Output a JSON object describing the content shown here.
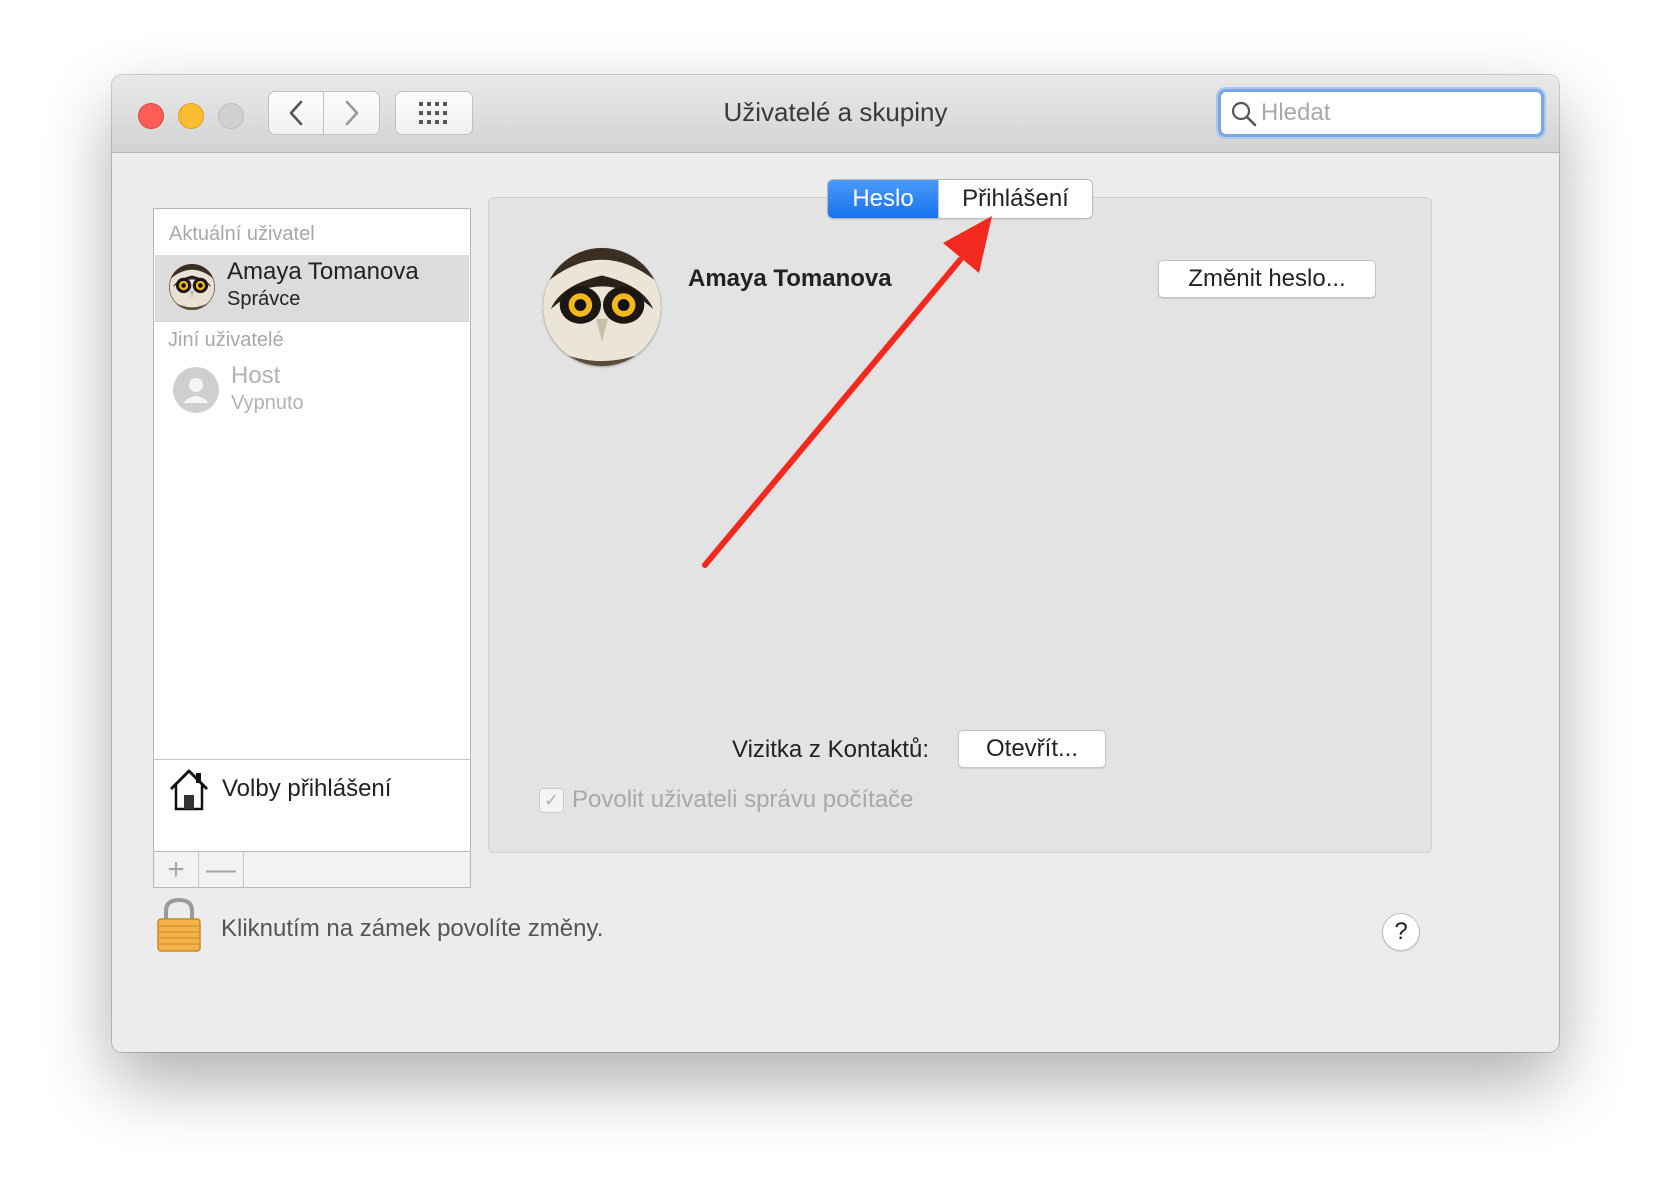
{
  "window": {
    "title": "Uživatelé a skupiny"
  },
  "search": {
    "placeholder": "Hledat"
  },
  "sidebar": {
    "current_header": "Aktuální uživatel",
    "current_user": {
      "name": "Amaya Tomanova",
      "role": "Správce"
    },
    "others_header": "Jiní uživatelé",
    "other_users": [
      {
        "name": "Host",
        "status": "Vypnuto"
      }
    ],
    "login_options_label": "Volby přihlášení",
    "add_label": "+",
    "remove_label": "—"
  },
  "tabs": [
    {
      "label": "Heslo",
      "active": true
    },
    {
      "label": "Přihlášení",
      "active": false
    }
  ],
  "main": {
    "user_name": "Amaya Tomanova",
    "change_password_label": "Změnit heslo...",
    "contacts_label": "Vizitka z Kontaktů:",
    "open_label": "Otevřít...",
    "allow_admin_label": "Povolit uživateli správu počítače",
    "allow_admin_checked": true
  },
  "footer": {
    "lock_text": "Kliknutím na zámek povolíte změny.",
    "help_label": "?"
  },
  "colors": {
    "accent": "#1774ee",
    "annotation_arrow": "#f22a1d"
  }
}
